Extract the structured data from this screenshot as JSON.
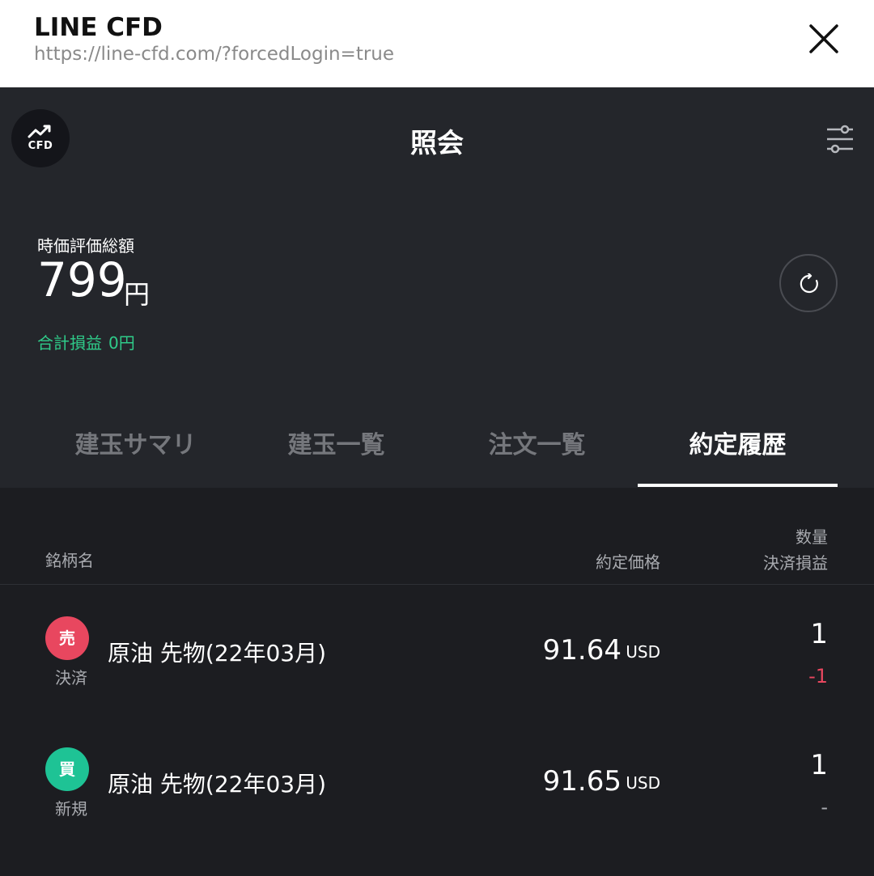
{
  "browser": {
    "title": "LINE CFD",
    "url": "https://line-cfd.com/?forcedLogin=true"
  },
  "header": {
    "logo_text": "CFD",
    "title": "照会"
  },
  "summary": {
    "label": "時価評価総額",
    "amount": "799",
    "unit": "円",
    "pnl_label": "合計損益",
    "pnl_value": "0円"
  },
  "tabs": [
    {
      "label": "建玉サマリ",
      "active": false
    },
    {
      "label": "建玉一覧",
      "active": false
    },
    {
      "label": "注文一覧",
      "active": false
    },
    {
      "label": "約定履歴",
      "active": true
    }
  ],
  "columns": {
    "name": "銘柄名",
    "price": "約定価格",
    "quantity": "数量",
    "pnl": "決済損益"
  },
  "trades": [
    {
      "side": "売",
      "type": "決済",
      "instrument": "原油 先物(22年03月)",
      "price": "91.64",
      "currency": "USD",
      "quantity": "1",
      "pnl": "-1"
    },
    {
      "side": "買",
      "type": "新規",
      "instrument": "原油 先物(22年03月)",
      "price": "91.65",
      "currency": "USD",
      "quantity": "1",
      "pnl": "-"
    }
  ],
  "colors": {
    "sell": "#e8475f",
    "buy": "#1ec395",
    "profit": "#2fcc8a",
    "background": "#1c1d21"
  },
  "icons": {
    "close": "close-icon",
    "filter": "filter-icon",
    "refresh": "refresh-icon",
    "logo": "chart-trend-icon"
  }
}
